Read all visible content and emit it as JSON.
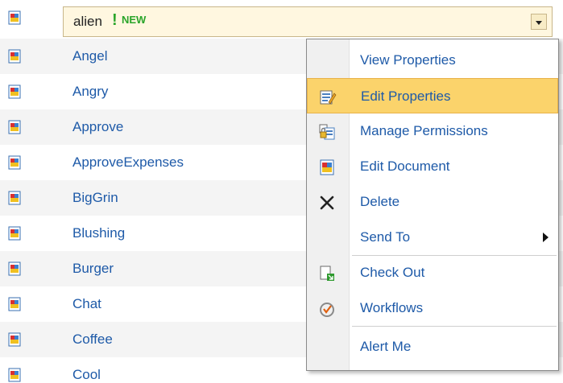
{
  "list": {
    "selected": {
      "label": "alien",
      "badge": "NEW",
      "exclaim": "!"
    },
    "items": [
      {
        "label": "Angel"
      },
      {
        "label": "Angry"
      },
      {
        "label": "Approve"
      },
      {
        "label": "ApproveExpenses"
      },
      {
        "label": "BigGrin"
      },
      {
        "label": "Blushing"
      },
      {
        "label": "Burger"
      },
      {
        "label": "Chat"
      },
      {
        "label": "Coffee"
      },
      {
        "label": "Cool"
      }
    ]
  },
  "menu": {
    "items": [
      {
        "label": "View Properties",
        "icon": "none"
      },
      {
        "label": "Edit Properties",
        "icon": "edit-properties-icon"
      },
      {
        "label": "Manage Permissions",
        "icon": "permissions-icon"
      },
      {
        "label": "Edit Document",
        "icon": "document-icon"
      },
      {
        "label": "Delete",
        "icon": "delete-x-icon"
      },
      {
        "label": "Send To",
        "icon": "none",
        "submenu": true
      },
      {
        "label": "Check Out",
        "icon": "check-out-icon"
      },
      {
        "label": "Workflows",
        "icon": "workflow-icon"
      },
      {
        "label": "Alert Me",
        "icon": "none"
      }
    ]
  },
  "colors": {
    "link": "#1e5aa8",
    "highlight": "#fbd36b",
    "new_badge": "#2aa52a"
  }
}
